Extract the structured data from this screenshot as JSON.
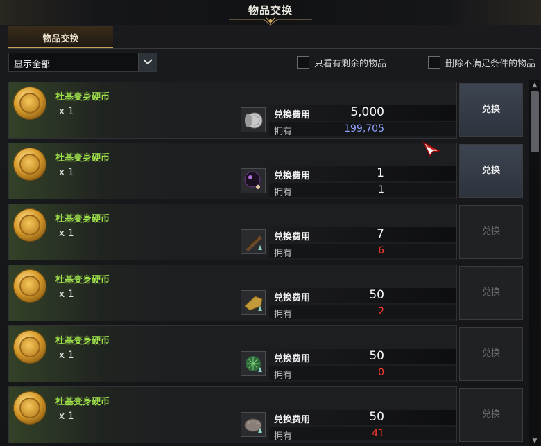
{
  "window": {
    "title": "物品交换"
  },
  "tabs": [
    {
      "label": "物品交换"
    }
  ],
  "filter": {
    "selected": "显示全部"
  },
  "options": {
    "show_remaining": "只看有剩余的物品",
    "hide_unmet": "删除不满足条件的物品"
  },
  "labels": {
    "cost": "兑换费用",
    "own": "拥有"
  },
  "colors": {
    "item_name": "#9ee04a",
    "own_ok": "#8fa3ff",
    "own_lack": "#ff3b30",
    "own_neutral": "#f0f0f0"
  },
  "rows": [
    {
      "name": "杜基变身硬币",
      "qty": "x 1",
      "cost_icon": "silver-coin-icon",
      "cost": "5,000",
      "own": "199,705",
      "own_state": "ok",
      "button": "兑换",
      "enabled": true
    },
    {
      "name": "杜基变身硬币",
      "qty": "x 1",
      "cost_icon": "dark-orb-icon",
      "cost": "1",
      "own": "1",
      "own_state": "neutral",
      "button": "兑换",
      "enabled": true
    },
    {
      "name": "杜基变身硬币",
      "qty": "x 1",
      "cost_icon": "wood-material-icon",
      "cost": "7",
      "own": "6",
      "own_state": "lack",
      "button": "兑换",
      "enabled": false
    },
    {
      "name": "杜基变身硬币",
      "qty": "x 1",
      "cost_icon": "leather-material-icon",
      "cost": "50",
      "own": "2",
      "own_state": "lack",
      "button": "兑换",
      "enabled": false
    },
    {
      "name": "杜基变身硬币",
      "qty": "x 1",
      "cost_icon": "herb-material-icon",
      "cost": "50",
      "own": "0",
      "own_state": "lack",
      "button": "兑换",
      "enabled": false
    },
    {
      "name": "杜基变身硬币",
      "qty": "x 1",
      "cost_icon": "stone-material-icon",
      "cost": "50",
      "own": "41",
      "own_state": "lack",
      "button": "兑换",
      "enabled": false
    }
  ]
}
